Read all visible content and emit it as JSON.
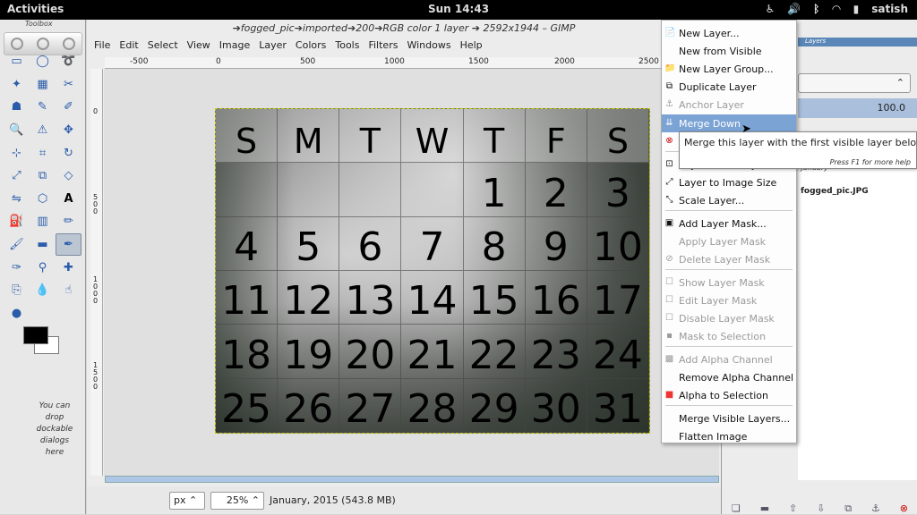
{
  "topbar": {
    "activities": "Activities",
    "clock": "Sun 14:43",
    "user": "satish"
  },
  "toolbox": {
    "title": "Toolbox",
    "drop_note": "You can drop dockable dialogs here"
  },
  "window": {
    "title": "➔fogged_pic➔imported➔200➔RGB color 1 layer ➔ 2592x1944 – GIMP",
    "menu": [
      "File",
      "Edit",
      "Select",
      "View",
      "Image",
      "Layer",
      "Colors",
      "Tools",
      "Filters",
      "Windows",
      "Help"
    ]
  },
  "rulers": {
    "h": [
      "-500",
      "0",
      "500",
      "1000",
      "1500",
      "2000",
      "2500"
    ],
    "v": [
      "0",
      "500",
      "1000",
      "1500"
    ]
  },
  "calendar": {
    "days": [
      "S",
      "M",
      "T",
      "W",
      "T",
      "F",
      "S"
    ],
    "cells": [
      "",
      "",
      "",
      "",
      "1",
      "2",
      "3",
      "4",
      "5",
      "6",
      "7",
      "8",
      "9",
      "10",
      "11",
      "12",
      "13",
      "14",
      "15",
      "16",
      "17",
      "18",
      "19",
      "20",
      "21",
      "22",
      "23",
      "24",
      "25",
      "26",
      "27",
      "28",
      "29",
      "30",
      "31"
    ]
  },
  "status": {
    "unit": "px",
    "zoom": "25%",
    "info": "January, 2015 (543.8 MB)"
  },
  "layers": {
    "tab": "Layers",
    "opacity": "100.0",
    "layer1": "January",
    "layer2": "fogged_pic.JPG"
  },
  "menu": {
    "items": [
      {
        "label": "New Layer...",
        "disabled": false,
        "icon": "new-layer-icon"
      },
      {
        "label": "New from Visible",
        "disabled": false,
        "icon": ""
      },
      {
        "label": "New Layer Group...",
        "disabled": false,
        "icon": "folder-icon"
      },
      {
        "label": "Duplicate Layer",
        "disabled": false,
        "icon": "duplicate-icon"
      },
      {
        "label": "Anchor Layer",
        "disabled": true,
        "icon": "anchor-icon"
      },
      {
        "label": "Merge Down",
        "disabled": false,
        "icon": "merge-icon",
        "highlighted": true
      },
      {
        "label": "Delete Layer",
        "disabled": false,
        "icon": "delete-icon"
      },
      {
        "label": "Layer Boundary Size...",
        "disabled": false,
        "icon": "boundary-icon"
      },
      {
        "label": "Layer to Image Size",
        "disabled": false,
        "icon": "layer-size-icon"
      },
      {
        "label": "Scale Layer...",
        "disabled": false,
        "icon": "scale-icon"
      },
      {
        "label": "Add Layer Mask...",
        "disabled": false,
        "icon": "mask-icon"
      },
      {
        "label": "Apply Layer Mask",
        "disabled": true,
        "icon": ""
      },
      {
        "label": "Delete Layer Mask",
        "disabled": true,
        "icon": "delete-mask-icon"
      },
      {
        "label": "Show Layer Mask",
        "disabled": true,
        "icon": "checkbox-icon"
      },
      {
        "label": "Edit Layer Mask",
        "disabled": true,
        "icon": "checkbox-icon"
      },
      {
        "label": "Disable Layer Mask",
        "disabled": true,
        "icon": "checkbox-icon"
      },
      {
        "label": "Mask to Selection",
        "disabled": true,
        "icon": "mask-selection-icon"
      },
      {
        "label": "Add Alpha Channel",
        "disabled": true,
        "icon": "alpha-icon"
      },
      {
        "label": "Remove Alpha Channel",
        "disabled": false,
        "icon": ""
      },
      {
        "label": "Alpha to Selection",
        "disabled": false,
        "icon": "alpha-selection-icon"
      },
      {
        "label": "Merge Visible Layers...",
        "disabled": false,
        "icon": ""
      },
      {
        "label": "Flatten Image",
        "disabled": false,
        "icon": ""
      }
    ]
  },
  "tooltip": {
    "text": "Merge this layer with the first visible layer below it",
    "hint": "Press F1 for more help"
  }
}
